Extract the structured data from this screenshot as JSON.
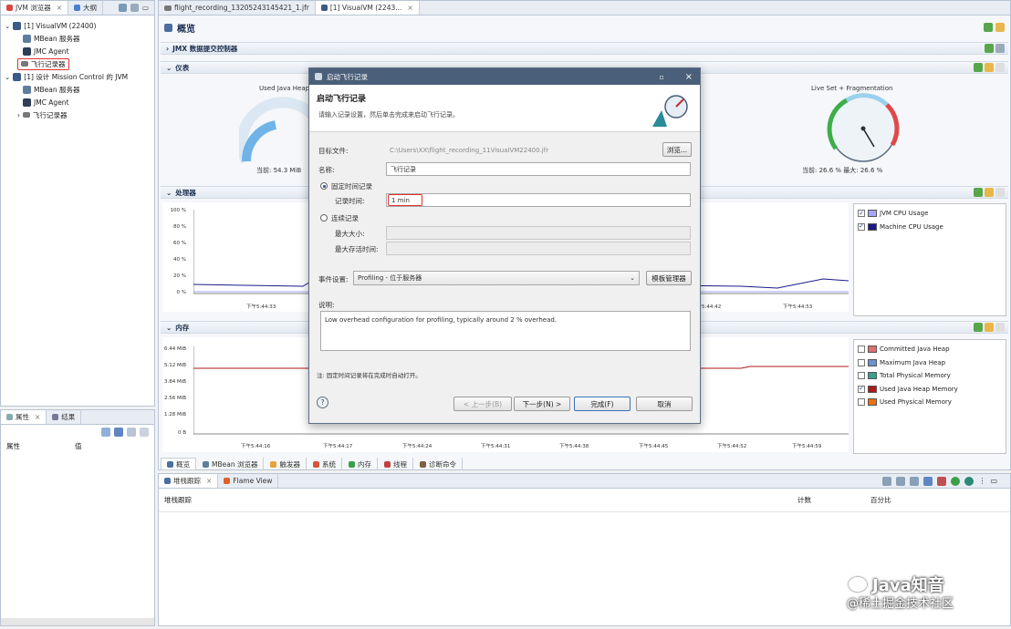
{
  "left_panel": {
    "tabs": [
      {
        "label": "JVM 浏览器",
        "active": true
      },
      {
        "label": "大纲",
        "active": false
      }
    ],
    "tree": [
      {
        "label": "[1] VisualVM (22400)",
        "level": 0,
        "icon": "jvm-icon"
      },
      {
        "label": "MBean 服务器",
        "level": 1,
        "icon": "mbean-icon"
      },
      {
        "label": "JMC Agent",
        "level": 1,
        "icon": "agent-icon"
      },
      {
        "label": "飞行记录器",
        "level": 1,
        "icon": "recorder-icon",
        "highlighted": true
      },
      {
        "label": "[1] 设计 Mission Control 的 JVM",
        "level": 0,
        "icon": "jvm-icon"
      },
      {
        "label": "MBean 服务器",
        "level": 1,
        "icon": "mbean-icon"
      },
      {
        "label": "JMC Agent",
        "level": 1,
        "icon": "agent-icon"
      },
      {
        "label": "飞行记录器",
        "level": 1,
        "icon": "recorder-icon"
      }
    ]
  },
  "props_panel": {
    "tabs": [
      {
        "label": "属性",
        "active": true
      },
      {
        "label": "结果",
        "active": false
      }
    ],
    "columns": [
      "属性",
      "值"
    ]
  },
  "editor_tabs": [
    {
      "label": "flight_recording_13205243145421_1.jfr",
      "active": false
    },
    {
      "label": "[1] VisualVM (2243...",
      "active": true
    }
  ],
  "overview": {
    "title": "概览",
    "sections": {
      "mbean": "JMX 数据提交控制器",
      "dashboard": "仪表",
      "processor": "处理器",
      "memory": "内存"
    },
    "gauges": [
      {
        "title": "Used Java Heap",
        "reading": "当前: 54.3 MiB"
      },
      {
        "title": "Live Set + Fragmentation",
        "reading": "当前: 26.6 %  最大: 26.6 %"
      }
    ],
    "cpu_chart": {
      "yticks": [
        "100 %",
        "80 %",
        "60 %",
        "40 %",
        "20 %",
        "0 %"
      ],
      "xticks": [
        "下午5:44:33",
        "下午5:44:42",
        "下午5:44:53"
      ],
      "legend": [
        {
          "label": "JVM CPU Usage",
          "color": "#a6a6ff",
          "checked": true
        },
        {
          "label": "Machine CPU Usage",
          "color": "#1a1a8c",
          "checked": true
        }
      ]
    },
    "mem_chart": {
      "yticks": [
        "6.44 MiB",
        "5.12 MiB",
        "3.84 MiB",
        "2.56 MiB",
        "1.28 MiB",
        "0 B"
      ],
      "xticks": [
        "下午5:44:16",
        "下午5:44:17",
        "下午5:44:24",
        "下午5:44:31",
        "下午5:44:38",
        "下午5:44:45",
        "下午5:44:52",
        "下午5:44:59"
      ],
      "legend": [
        {
          "label": "Committed Java Heap",
          "color": "#e07070",
          "checked": false
        },
        {
          "label": "Maximum Java Heap",
          "color": "#7090d0",
          "checked": false
        },
        {
          "label": "Total Physical Memory",
          "color": "#3aa08a",
          "checked": false
        },
        {
          "label": "Used Java Heap Memory",
          "color": "#b01818",
          "checked": true
        },
        {
          "label": "Used Physical Memory",
          "color": "#f07010",
          "checked": false
        }
      ]
    },
    "bottom_tabs": [
      "概览",
      "MBean 浏览器",
      "触发器",
      "系统",
      "内存",
      "线程",
      "诊断命令"
    ]
  },
  "stack_panel": {
    "tabs": [
      {
        "label": "堆栈跟踪",
        "active": true
      },
      {
        "label": "Flame View",
        "active": false
      }
    ],
    "columns": [
      "堆栈跟踪",
      "计数",
      "百分比"
    ]
  },
  "dialog": {
    "window_title": "启动飞行记录",
    "heading": "启动飞行记录",
    "subheading": "请输入记录设置，然后单击完成来启动飞行记录。",
    "labels": {
      "file": "目标文件:",
      "name": "名称:",
      "fixed": "固定时间记录",
      "duration": "记录时间:",
      "continuous": "连续记录",
      "max_size": "最大大小:",
      "max_age": "最大存活时间:",
      "template": "事件设置:",
      "description": "说明:"
    },
    "values": {
      "file": "C:\\Users\\XX\\flight_recording_11VisualVM22400.jfr",
      "name": "飞行记录",
      "duration": "1 min",
      "template": "Profiling - 位于服务器",
      "description": "Low overhead configuration for profiling, typically around 2 % overhead."
    },
    "buttons": {
      "browse": "浏览...",
      "template_manager": "模板管理器",
      "back": "< 上一步(B)",
      "next": "下一步(N) >",
      "finish": "完成(F)",
      "cancel": "取消"
    },
    "note": "注: 固定时间记录将在完成时自动打开。"
  },
  "watermark": {
    "brand": "Java知音",
    "site": "@稀土掘金技术社区"
  }
}
